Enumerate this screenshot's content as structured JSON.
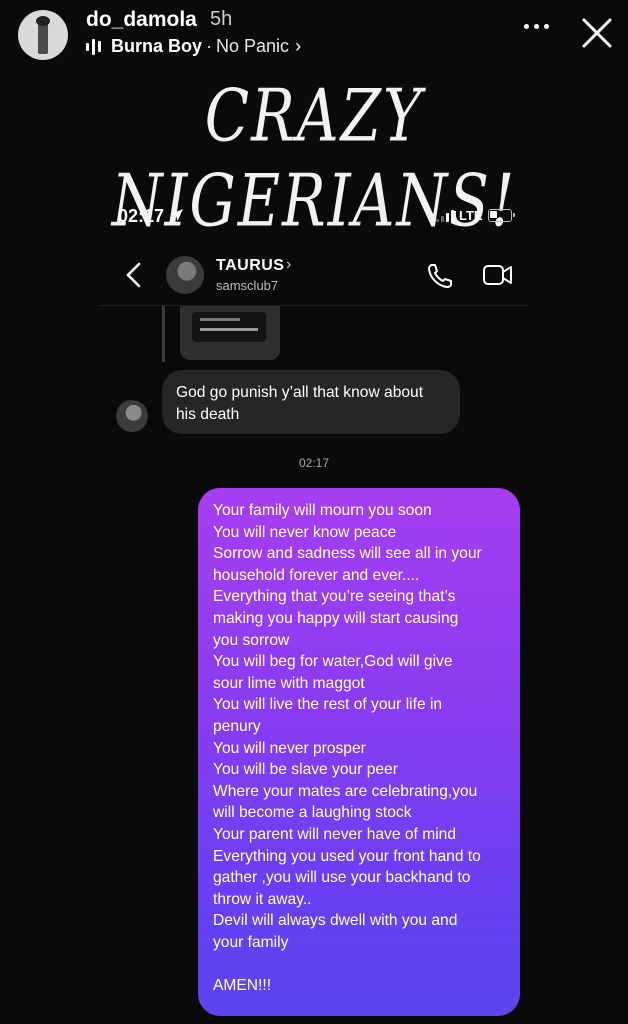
{
  "story": {
    "username": "do_damola",
    "time": "5h",
    "music": {
      "artist": "Burna Boy",
      "separator": "·",
      "song": "No Panic",
      "chevron": "›"
    }
  },
  "headline": "CRAZY NIGERIANS!",
  "screenshot": {
    "status_bar": {
      "time": "02:17",
      "network": "LTE"
    },
    "dm_header": {
      "name": "TAURUS",
      "chevron": "›",
      "handle": "samsclub7"
    },
    "incoming_message": {
      "lines": [
        "God go punish y’all that know about",
        "his death"
      ]
    },
    "timestamp": "02:17",
    "outgoing_message": {
      "lines": [
        "Your family will mourn you soon",
        "You will never know peace",
        "Sorrow and sadness will see all in your",
        "household forever and ever....",
        "Everything that you’re seeing that’s",
        "making you happy will start causing",
        "you sorrow",
        "You will beg for water,God will give",
        "sour lime with maggot",
        "You will live the rest of your life in",
        "penury",
        "You will never prosper",
        "You will be slave your peer",
        "Where your mates are celebrating,you",
        "will become a laughing stock",
        "Your parent will never have of mind",
        "Everything you used your front hand to",
        "gather ,you will use your backhand to",
        "throw it away..",
        "Devil will always dwell with you and",
        "your family",
        "",
        "AMEN!!!"
      ]
    }
  },
  "colors": {
    "background": "#0a0a0a",
    "incoming_bubble": "#262626",
    "outgoing_gradient_top": "#a43ff0",
    "outgoing_gradient_bottom": "#5a45ee"
  },
  "icons": [
    "equalizer-icon",
    "more-icon",
    "close-icon",
    "location-arrow-icon",
    "signal-icon",
    "battery-icon",
    "back-icon",
    "phone-icon",
    "video-icon"
  ]
}
